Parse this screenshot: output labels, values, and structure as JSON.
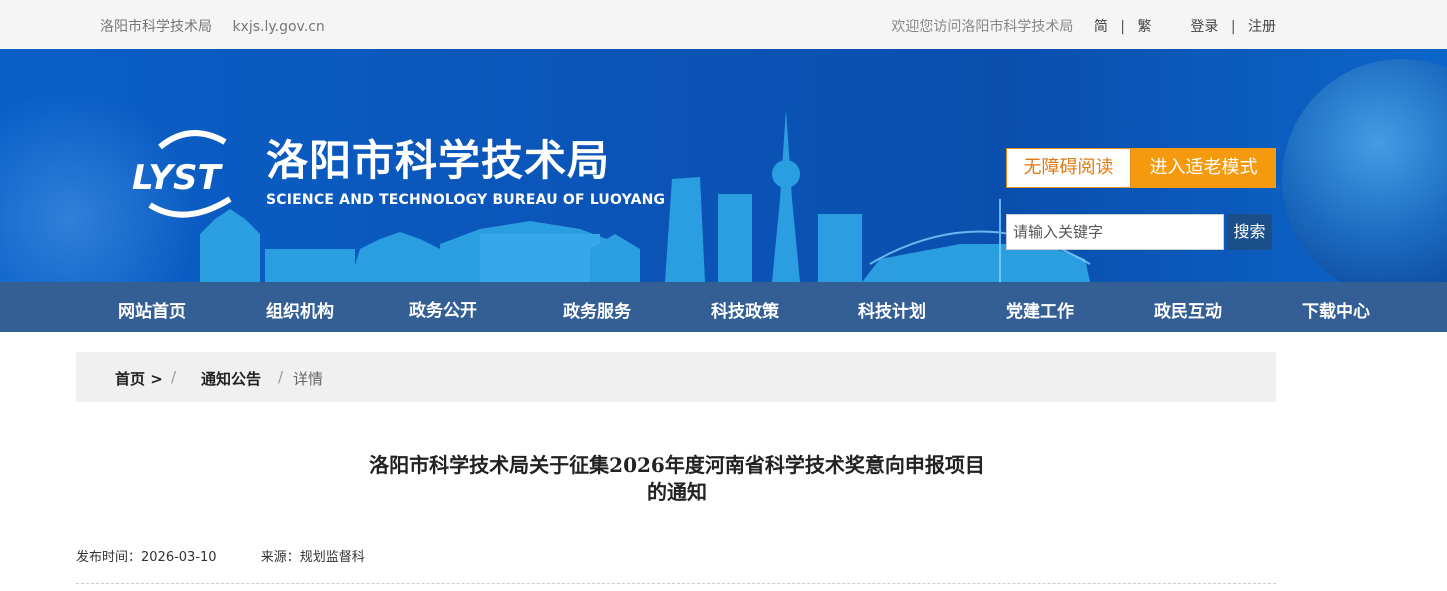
{
  "topbar": {
    "site_name": "洛阳市科学技术局",
    "domain": "kxjs.ly.gov.cn",
    "welcome": "欢迎您访问洛阳市科学技术局",
    "lang_simplified": "简",
    "lang_sep": "|",
    "lang_traditional": "繁",
    "login": "登录",
    "auth_sep": "|",
    "register": "注册"
  },
  "header": {
    "logo_mark_text": "LYST",
    "title_cn": "洛阳市科学技术局",
    "title_en": "SCIENCE AND TECHNOLOGY BUREAU OF LUOYANG",
    "accessible_label": "无障碍阅读",
    "elder_mode_label": "进入适老模式",
    "search_placeholder": "请输入关键字",
    "search_button": "搜索"
  },
  "nav": {
    "items": [
      "网站首页",
      "组织机构",
      "政务公开",
      "政务服务",
      "科技政策",
      "科技计划",
      "党建工作",
      "政民互动",
      "下载中心"
    ]
  },
  "breadcrumb": {
    "home": "首页 >",
    "sep1": "/",
    "section": "通知公告",
    "sep2": "/",
    "current": "详情"
  },
  "article": {
    "title_line1": "洛阳市科学技术局关于征集2026年度河南省科学技术奖意向申报项目",
    "title_line2": "的通知",
    "publish_label": "发布时间：",
    "publish_date": "2026-03-10",
    "source_label": "来源：",
    "source": "规划监督科"
  },
  "colors": {
    "banner": "#0b55b8",
    "nav": "#335f94",
    "elder_button": "#f5990f",
    "search_button": "#1a4f8a"
  }
}
